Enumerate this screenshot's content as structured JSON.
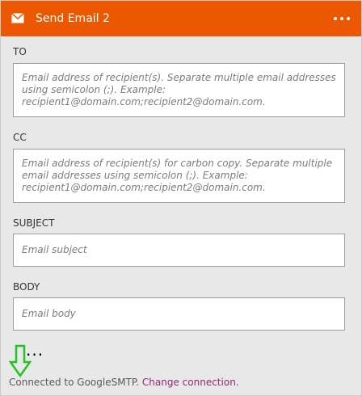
{
  "header": {
    "title": "Send Email 2",
    "icon": "mail-icon",
    "menu_icon": "more-options-icon",
    "color": "#eb5800"
  },
  "fields": {
    "to": {
      "label": "TO",
      "placeholder": "Email address of recipient(s). Separate multiple email addresses using semicolon (;). Example: recipient1@domain.com;recipient2@domain.com."
    },
    "cc": {
      "label": "CC",
      "placeholder": "Email address of recipient(s) for carbon copy. Separate multiple email addresses using semicolon (;). Example: recipient1@domain.com;recipient2@domain.com."
    },
    "subject": {
      "label": "SUBJECT",
      "placeholder": "Email subject"
    },
    "body": {
      "label": "BODY",
      "placeholder": "Email body"
    }
  },
  "advanced": {
    "label": "..."
  },
  "annotation": {
    "icon": "down-arrow-icon",
    "color": "#22c322"
  },
  "footer": {
    "status_text": "Connected to GoogleSMTP.",
    "link_text": "Change connection."
  }
}
